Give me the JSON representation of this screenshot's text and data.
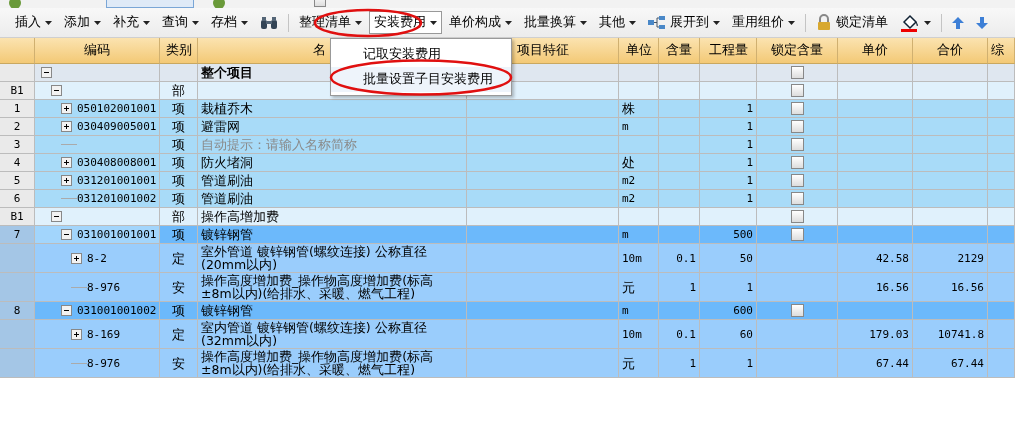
{
  "top_toolbar": {
    "items": [
      {
        "kind": "button"
      },
      {
        "kind": "toggle",
        "selected": true
      },
      {
        "kind": "button"
      },
      {
        "kind": "checkbox",
        "checked": false
      }
    ]
  },
  "toolbar": {
    "items": [
      {
        "kind": "menu",
        "label": "插入"
      },
      {
        "kind": "menu",
        "label": "添加"
      },
      {
        "kind": "menu",
        "label": "补充"
      },
      {
        "kind": "menu",
        "label": "查询"
      },
      {
        "kind": "menu",
        "label": "存档"
      },
      {
        "kind": "find"
      },
      {
        "kind": "sep"
      },
      {
        "kind": "menu",
        "label": "整理清单"
      },
      {
        "kind": "menu",
        "label": "安装费用",
        "selected": true
      },
      {
        "kind": "menu",
        "label": "单价构成"
      },
      {
        "kind": "menu",
        "label": "批量换算"
      },
      {
        "kind": "menu",
        "label": "其他"
      },
      {
        "kind": "tree-menu",
        "label": "展开到"
      },
      {
        "kind": "menu",
        "label": "重用组价"
      },
      {
        "kind": "sep"
      },
      {
        "kind": "lock",
        "label": "锁定清单"
      },
      {
        "kind": "fill"
      },
      {
        "kind": "sep"
      },
      {
        "kind": "up"
      },
      {
        "kind": "down"
      }
    ]
  },
  "dropdown": {
    "items": [
      {
        "label": "记取安装费用",
        "selected": false
      },
      {
        "label": "批量设置子目安装费用",
        "selected": true
      }
    ]
  },
  "table": {
    "columns": [
      "",
      "编码",
      "类别",
      "名",
      "项目特征",
      "单位",
      "含量",
      "工程量",
      "锁定含量",
      "单价",
      "合价",
      "综"
    ],
    "rows": [
      {
        "kind": "root",
        "name": "整个项目",
        "expanded": true,
        "lock": {
          "checked": false
        },
        "children": [
          {
            "kind": "section",
            "num": "B1",
            "type": "部",
            "expanded": true,
            "lock": {
              "checked": false
            },
            "children": [
              {
                "kind": "item",
                "num": "1",
                "code": "050102001001",
                "type": "项",
                "name": "栽植乔木",
                "expanded": false,
                "unit": "株",
                "quantity": "1",
                "lock": {
                  "checked": false
                }
              },
              {
                "kind": "item",
                "num": "2",
                "code": "030409005001",
                "type": "项",
                "name": "避雷网",
                "expanded": false,
                "unit": "m",
                "quantity": "1",
                "lock": {
                  "checked": false
                }
              },
              {
                "kind": "item",
                "num": "3",
                "type": "项",
                "hint": "自动提示：请输入名称简称",
                "quantity": "1",
                "lock": {
                  "checked": false
                }
              },
              {
                "kind": "item",
                "num": "4",
                "code": "030408008001",
                "type": "项",
                "name": "防火堵洞",
                "expanded": false,
                "unit": "处",
                "quantity": "1",
                "lock": {
                  "checked": false
                }
              },
              {
                "kind": "item",
                "num": "5",
                "code": "031201001001",
                "type": "项",
                "name": "管道刷油",
                "expanded": false,
                "unit": "m2",
                "quantity": "1",
                "lock": {
                  "checked": false
                }
              },
              {
                "kind": "item",
                "num": "6",
                "code": "031201001002",
                "type": "项",
                "name": "管道刷油",
                "unit": "m2",
                "quantity": "1",
                "lock": {
                  "checked": false
                }
              }
            ]
          },
          {
            "kind": "section",
            "num": "B1",
            "type": "部",
            "name": "操作高增加费",
            "expanded": true,
            "lock": {
              "checked": false
            },
            "children": [
              {
                "kind": "item",
                "num": "7",
                "code": "031001001001",
                "type": "项",
                "name": "镀锌钢管",
                "expanded": true,
                "highlighted": true,
                "unit": "m",
                "quantity": "500",
                "lock": {
                  "checked": false
                },
                "children": [
                  {
                    "kind": "sub",
                    "code": "8-2",
                    "type": "定",
                    "name": "室外管道 镀锌钢管(螺纹连接) 公称直径(20mm以内)",
                    "expanded": false,
                    "unit": "10m",
                    "ratio": "0.1",
                    "quantity": "50",
                    "price": "42.58",
                    "total": "2129"
                  },
                  {
                    "kind": "sub",
                    "code": "8-976",
                    "type": "安",
                    "name": "操作高度增加费_操作物高度增加费(标高±8m以内)(给排水、采暖、燃气工程)",
                    "unit": "元",
                    "ratio": "1",
                    "quantity": "1",
                    "price": "16.56",
                    "total": "16.56"
                  }
                ]
              },
              {
                "kind": "item",
                "num": "8",
                "code": "031001001002",
                "type": "项",
                "name": "镀锌钢管",
                "expanded": true,
                "highlighted": true,
                "unit": "m",
                "quantity": "600",
                "lock": {
                  "checked": false
                },
                "children": [
                  {
                    "kind": "sub",
                    "code": "8-169",
                    "type": "定",
                    "name": "室内管道 镀锌钢管(螺纹连接) 公称直径(32mm以内)",
                    "expanded": false,
                    "unit": "10m",
                    "ratio": "0.1",
                    "quantity": "60",
                    "price": "179.03",
                    "total": "10741.8"
                  },
                  {
                    "kind": "sub",
                    "code": "8-976",
                    "type": "安",
                    "name": "操作高度增加费_操作物高度增加费(标高±8m以内)(给排水、采暖、燃气工程)",
                    "unit": "元",
                    "ratio": "1",
                    "quantity": "1",
                    "price": "67.44",
                    "total": "67.44"
                  }
                ]
              }
            ]
          }
        ]
      }
    ]
  }
}
